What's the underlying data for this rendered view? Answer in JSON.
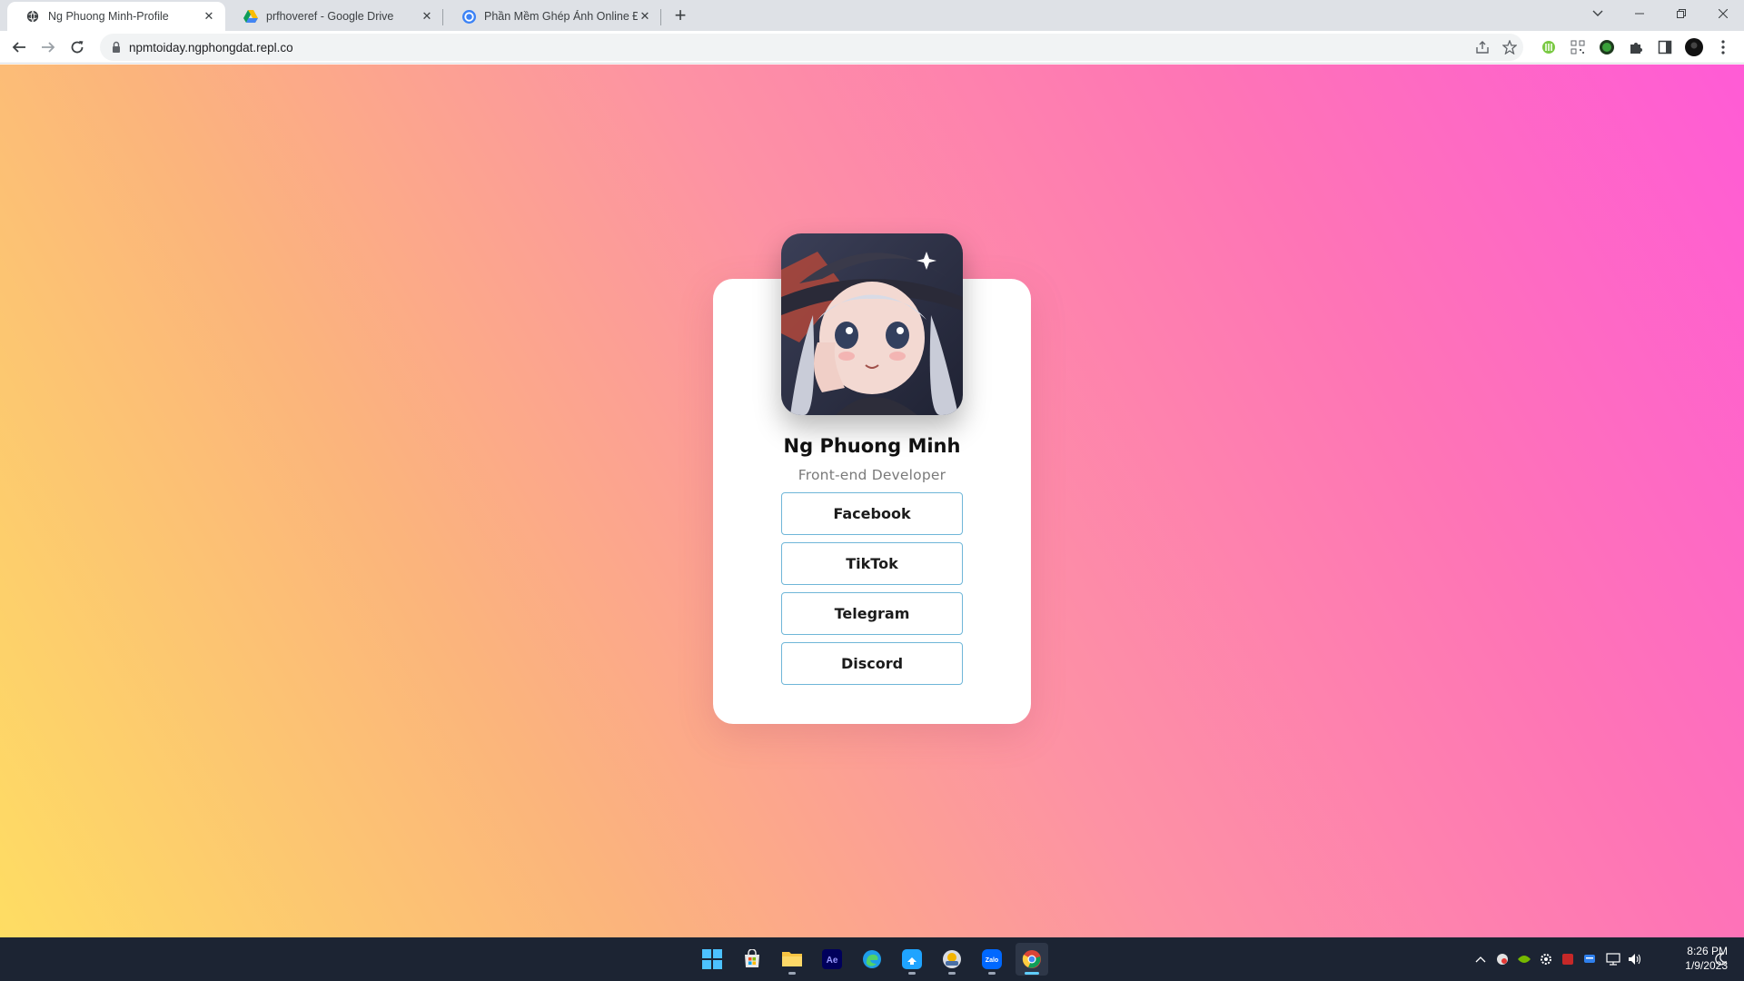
{
  "browser": {
    "tabs": [
      {
        "title": "Ng Phuong Minh-Profile",
        "active": true,
        "icon": "globe-icon"
      },
      {
        "title": "prfhoveref - Google Drive",
        "active": false,
        "icon": "google-drive-icon"
      },
      {
        "title": "Phần Mềm Ghép Ảnh Online Đẹp",
        "active": false,
        "icon": "canva-icon"
      }
    ],
    "url": "npmtoiday.ngphongdat.repl.co"
  },
  "profile": {
    "name": "Ng Phuong Minh",
    "role": "Front-end Developer",
    "links": [
      {
        "label": "Facebook"
      },
      {
        "label": "TikTok"
      },
      {
        "label": "Telegram"
      },
      {
        "label": "Discord"
      }
    ]
  },
  "taskbar": {
    "apps": [
      "windows-start-icon",
      "store-icon",
      "file-explorer-icon",
      "after-effects-icon",
      "edge-icon",
      "upload-app-icon",
      "app-icon",
      "zalo-icon",
      "chrome-icon"
    ],
    "zalo_label": "Zalo",
    "ae_label": "Ae",
    "time": "8:26 PM",
    "date": "1/9/2023"
  },
  "colors": {
    "gradient": [
      "#fedd63",
      "#fbb47c",
      "#fd92a4",
      "#fe74b6",
      "#ff5bd6"
    ],
    "button_border": "#6fb6d8",
    "taskbar": "#1c2433"
  }
}
